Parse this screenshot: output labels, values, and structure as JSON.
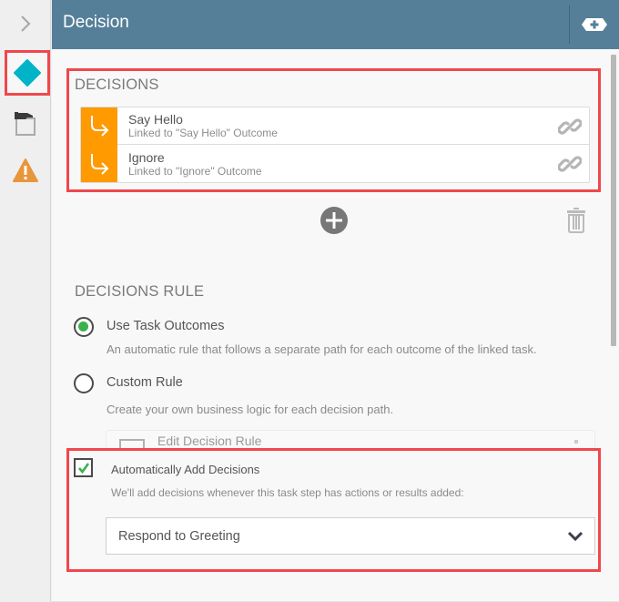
{
  "header": {
    "title": "Decision",
    "add_button_icon": "add-decision-icon"
  },
  "rail": {
    "toggle_icon": "chevron-right-icon",
    "items": [
      {
        "name": "decision",
        "icon": "diamond-icon",
        "color": "#00b4c8",
        "active": true
      },
      {
        "name": "task",
        "icon": "task-hand-icon",
        "active": false
      },
      {
        "name": "warnings",
        "icon": "warning-icon",
        "color": "#e8963c",
        "active": false
      }
    ]
  },
  "decisions": {
    "title": "DECISIONS",
    "items": [
      {
        "name": "Say Hello",
        "subtitle": "Linked to \"Say Hello\" Outcome"
      },
      {
        "name": "Ignore",
        "subtitle": "Linked to \"Ignore\" Outcome"
      }
    ],
    "accent_color": "#ff9a00"
  },
  "decisions_rule": {
    "title": "DECISIONS RULE",
    "options": [
      {
        "label": "Use Task Outcomes",
        "description": "An automatic rule that follows a separate path for each outcome of the linked task.",
        "selected": true
      },
      {
        "label": "Custom Rule",
        "description": "Create your own business logic for each decision path.",
        "selected": false
      }
    ],
    "edit_rule_label": "Edit Decision Rule"
  },
  "auto_add": {
    "label": "Automatically Add Decisions",
    "checked": true,
    "description": "We'll add decisions whenever this task step has actions or results added:",
    "select_value": "Respond to Greeting"
  },
  "colors": {
    "header_bg": "#557f98",
    "highlight": "#f0474c",
    "radio_checked": "#3ab24a"
  }
}
